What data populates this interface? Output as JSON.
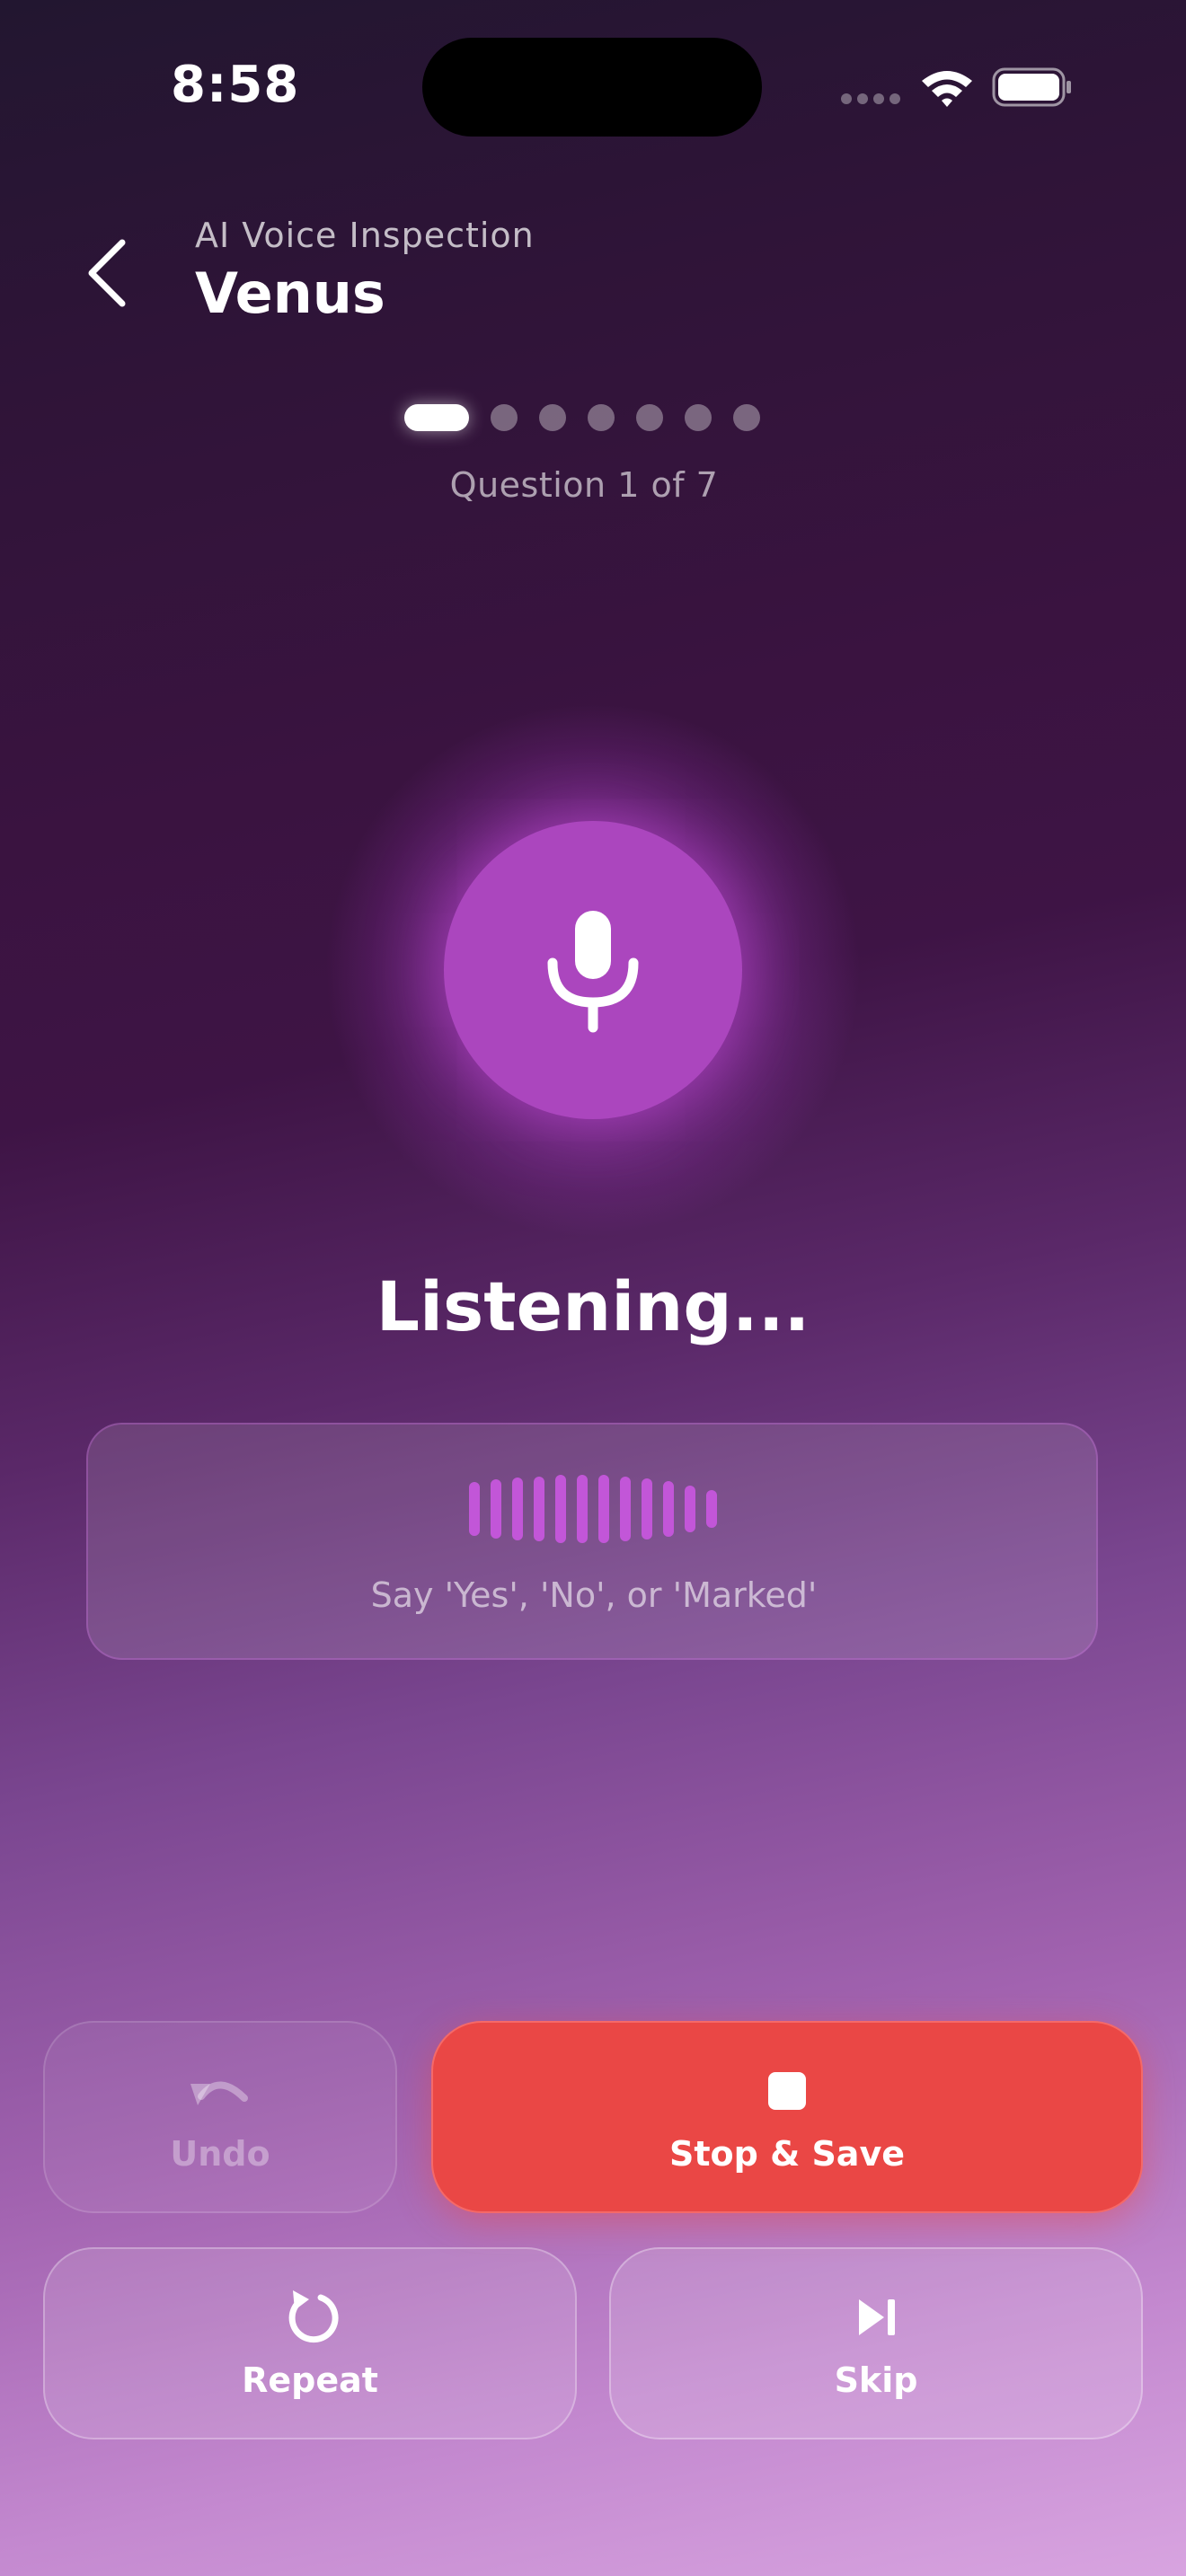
{
  "status_bar": {
    "time": "8:58",
    "icons": [
      "cellular-signal-icon",
      "wifi-icon",
      "battery-icon"
    ]
  },
  "header": {
    "back_icon": "chevron-left-icon",
    "subtitle": "AI Voice Inspection",
    "title": "Venus"
  },
  "progress": {
    "current": 1,
    "total": 7,
    "label": "Question 1 of 7"
  },
  "mic": {
    "icon": "microphone-icon",
    "status": "Listening..."
  },
  "prompt": {
    "waveform_icon": "waveform-icon",
    "hint": "Say 'Yes', 'No', or 'Marked'"
  },
  "actions": {
    "undo": {
      "label": "Undo",
      "icon": "undo-icon",
      "enabled": false
    },
    "stop": {
      "label": "Stop & Save",
      "icon": "stop-icon"
    },
    "repeat": {
      "label": "Repeat",
      "icon": "repeat-icon"
    },
    "skip": {
      "label": "Skip",
      "icon": "skip-forward-icon"
    }
  },
  "colors": {
    "accent_purple": "#ab46be",
    "stop_red": "#ea4745",
    "waveform": "#c256d8"
  }
}
